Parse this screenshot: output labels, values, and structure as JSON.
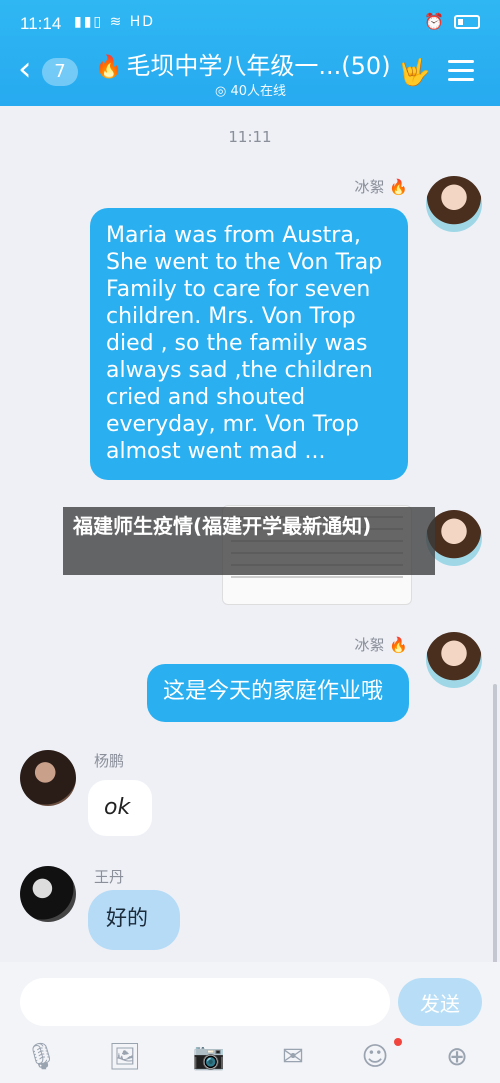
{
  "status": {
    "time": "11:14",
    "signals": "▮▮▯ ≋ HD"
  },
  "header": {
    "back_count": "7",
    "group_title": "毛坝中学八年级一...(50)",
    "online": "◎ 40人在线",
    "hand_icon": "🤟",
    "fire_icon": "🔥"
  },
  "chat": {
    "timestamp": "11:11",
    "messages": [
      {
        "sender": "冰絮 🔥",
        "text": "Maria was from Austra, She went to the Von Trap Family to care for seven children. Mrs. Von Trop died , so the family was always sad ,the children cried and shouted everyday, mr. Von Trop almost went mad ..."
      },
      {
        "sender": "冰絮 🔥",
        "text": "这是今天的家庭作业哦"
      },
      {
        "sender": "杨鹏",
        "text": "ok"
      },
      {
        "sender": "王丹",
        "text": "好的"
      }
    ],
    "overlay_text": "福建师生疫情(福建开学最新通知)"
  },
  "input": {
    "placeholder": "",
    "send_label": "发送"
  },
  "toolbar": {
    "icons": [
      "mic-icon",
      "image-icon",
      "camera-icon",
      "red-packet-icon",
      "emoji-icon",
      "plus-icon"
    ]
  }
}
